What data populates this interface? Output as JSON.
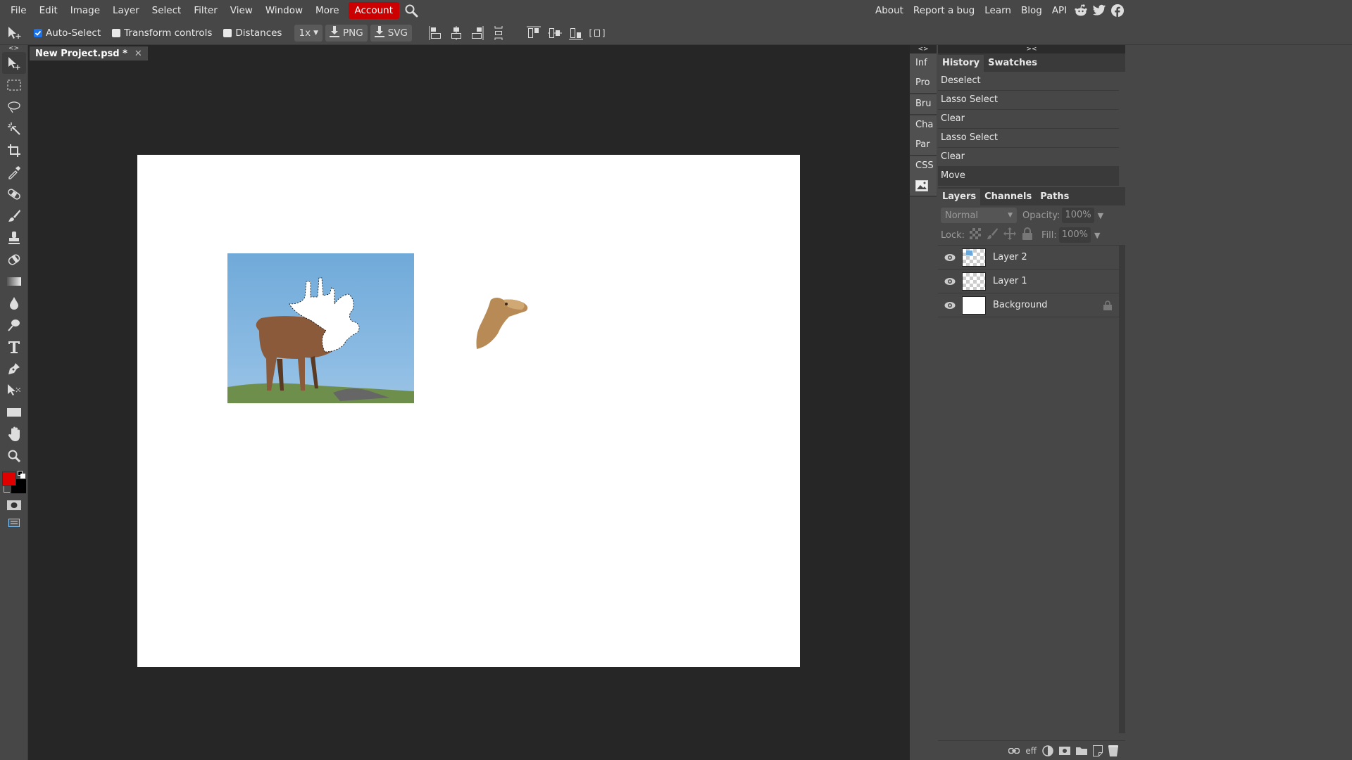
{
  "menu": {
    "items": [
      "File",
      "Edit",
      "Image",
      "Layer",
      "Select",
      "Filter",
      "View",
      "Window",
      "More"
    ],
    "account": "Account",
    "right_links": [
      "About",
      "Report a bug",
      "Learn",
      "Blog",
      "API"
    ],
    "social_icons": [
      "reddit-icon",
      "twitter-icon",
      "facebook-icon"
    ]
  },
  "options": {
    "auto_select": {
      "label": "Auto-Select",
      "checked": true
    },
    "transform_controls": {
      "label": "Transform controls",
      "checked": false
    },
    "distances": {
      "label": "Distances",
      "checked": false
    },
    "scale": "1x",
    "export_png": "PNG",
    "export_svg": "SVG"
  },
  "document": {
    "tab_title": "New Project.psd *",
    "close": "✕"
  },
  "toolbar": {
    "collapse": "<>",
    "tools": [
      "move",
      "rect-select",
      "lasso",
      "magic-wand",
      "crop",
      "eyedropper",
      "healing",
      "brush",
      "stamp",
      "eraser",
      "gradient",
      "blur",
      "dodge",
      "type",
      "pen",
      "path-select",
      "shape",
      "hand",
      "zoom"
    ],
    "foreground_color": "#e00000",
    "background_color": "#000000"
  },
  "dock": {
    "collapse": "<>",
    "items": [
      "Inf",
      "Pro",
      "Bru",
      "Cha",
      "Par",
      "CSS"
    ]
  },
  "history_panel": {
    "collapse": "><",
    "tabs": [
      "History",
      "Swatches"
    ],
    "items": [
      "Deselect",
      "Lasso Select",
      "Clear",
      "Lasso Select",
      "Clear",
      "Move"
    ],
    "current_index": 5
  },
  "layers_panel": {
    "tabs": [
      "Layers",
      "Channels",
      "Paths"
    ],
    "blend_mode": "Normal",
    "opacity_label": "Opacity:",
    "opacity": "100%",
    "lock_label": "Lock:",
    "fill_label": "Fill:",
    "fill": "100%",
    "layers": [
      {
        "name": "Layer 2",
        "visible": true,
        "locked": false
      },
      {
        "name": "Layer 1",
        "visible": true,
        "locked": false
      },
      {
        "name": "Background",
        "visible": true,
        "locked": true
      }
    ],
    "footer": {
      "effects": "eff"
    }
  }
}
